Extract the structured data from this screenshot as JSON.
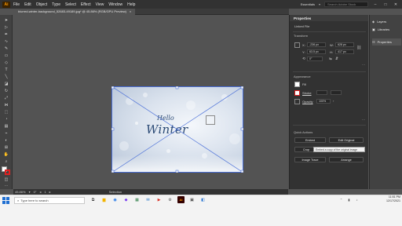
{
  "app": {
    "logo": "Ai"
  },
  "menu": [
    "File",
    "Edit",
    "Object",
    "Type",
    "Select",
    "Effect",
    "View",
    "Window",
    "Help"
  ],
  "top_right": {
    "workspace": "Essentials",
    "search_placeholder": "Search Adobe Stock"
  },
  "document_tab": {
    "title": "blurred-winter-background_52683-49189.jpg* @ 45.86% (RGB/GPU Preview)",
    "close": "×"
  },
  "artwork": {
    "line1": "Hello",
    "line2": "Winter"
  },
  "statusbar": {
    "zoom": "45.86%",
    "rotation": "0°",
    "artboard": "1",
    "tool": "Selection"
  },
  "properties": {
    "tab": "Properties",
    "subtitle": "Linked File",
    "transform": {
      "title": "Transform",
      "x_label": "X:",
      "x": "-236 px",
      "y_label": "Y:",
      "y": "63.5 px",
      "w_label": "W:",
      "w": "628 px",
      "h_label": "H:",
      "h": "417 px",
      "angle": "0°"
    },
    "appearance": {
      "title": "Appearance",
      "fill": "Fill",
      "stroke": "Stroke",
      "opacity_label": "Opacity",
      "opacity": "100%"
    },
    "quick_actions": {
      "title": "Quick Actions",
      "embed": "Embed",
      "edit_original": "Edit Original",
      "crop": "Crop",
      "tooltip": "Embed a copy of the original image",
      "image_trace": "Image Trace",
      "arrange": "Arrange"
    }
  },
  "dock": {
    "layers": "Layers",
    "libraries": "Libraries",
    "properties": "Properties"
  },
  "taskbar": {
    "search_placeholder": "Type here to search",
    "time": "11:51 PM",
    "date": "12/17/2021"
  },
  "colors": {
    "accent": "#2680eb",
    "brand": "#ff9a00"
  }
}
